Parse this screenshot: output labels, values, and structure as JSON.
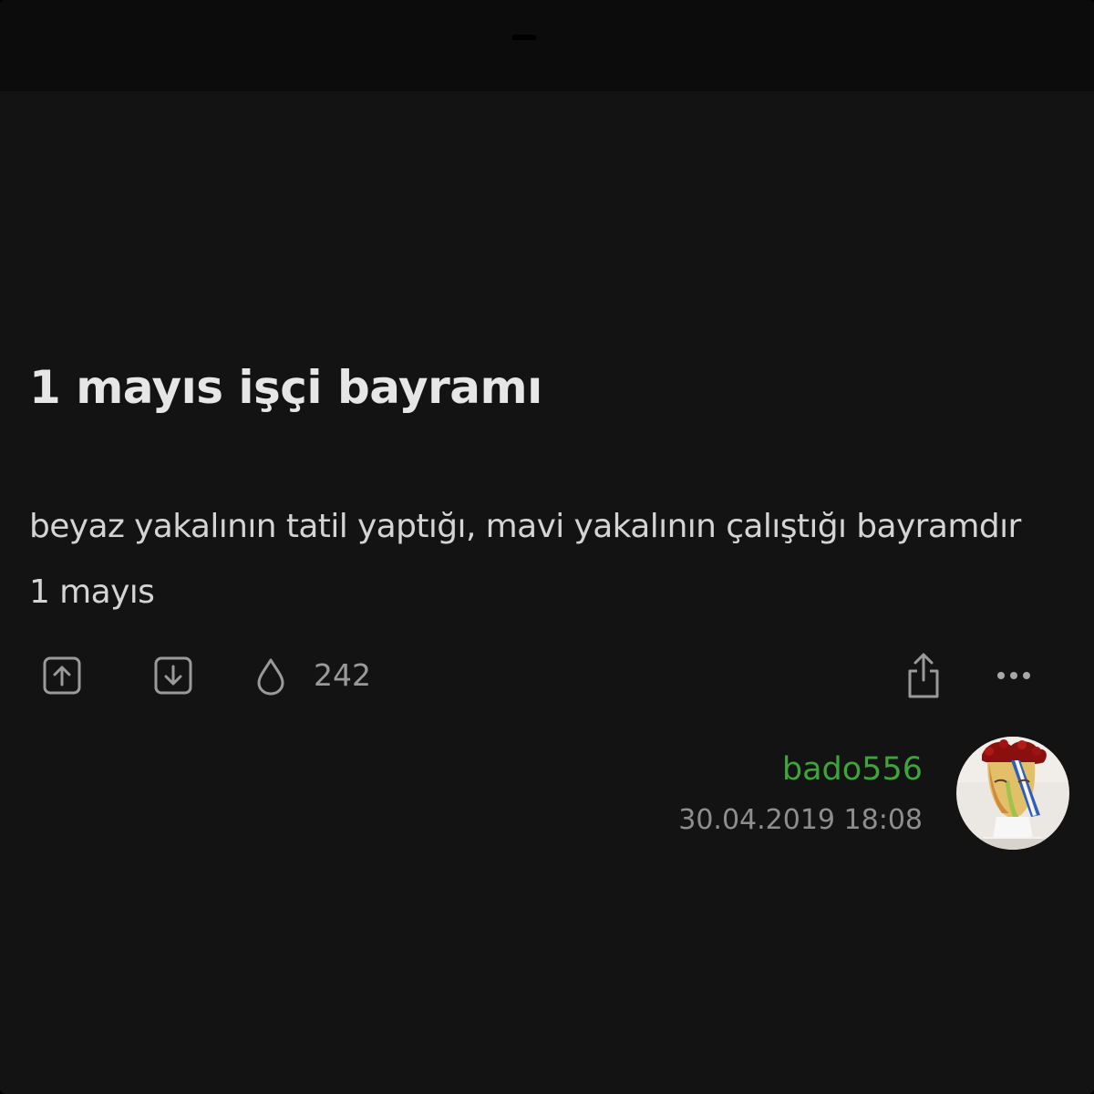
{
  "entry": {
    "title": "1 mayıs işçi bayramı",
    "body": "beyaz yakalının tatil yaptığı, mavi yakalının çalıştığı bayramdır 1 mayıs"
  },
  "actions": {
    "upvote_icon": "arrow-up-square-icon",
    "downvote_icon": "arrow-down-square-icon",
    "favorite_icon": "drop-icon",
    "favorite_count": "242",
    "share_icon": "share-icon",
    "more_icon": "more-horizontal-icon"
  },
  "author": {
    "username": "bado556",
    "date": "30.04.2019 18:08",
    "avatar": "bust-sculpture-avatar"
  },
  "colors": {
    "background": "#131313",
    "title": "#e6e6e6",
    "body": "#d4d4d4",
    "icon": "#9a9a9a",
    "username": "#3ea53b",
    "date": "#8e8e8e"
  }
}
